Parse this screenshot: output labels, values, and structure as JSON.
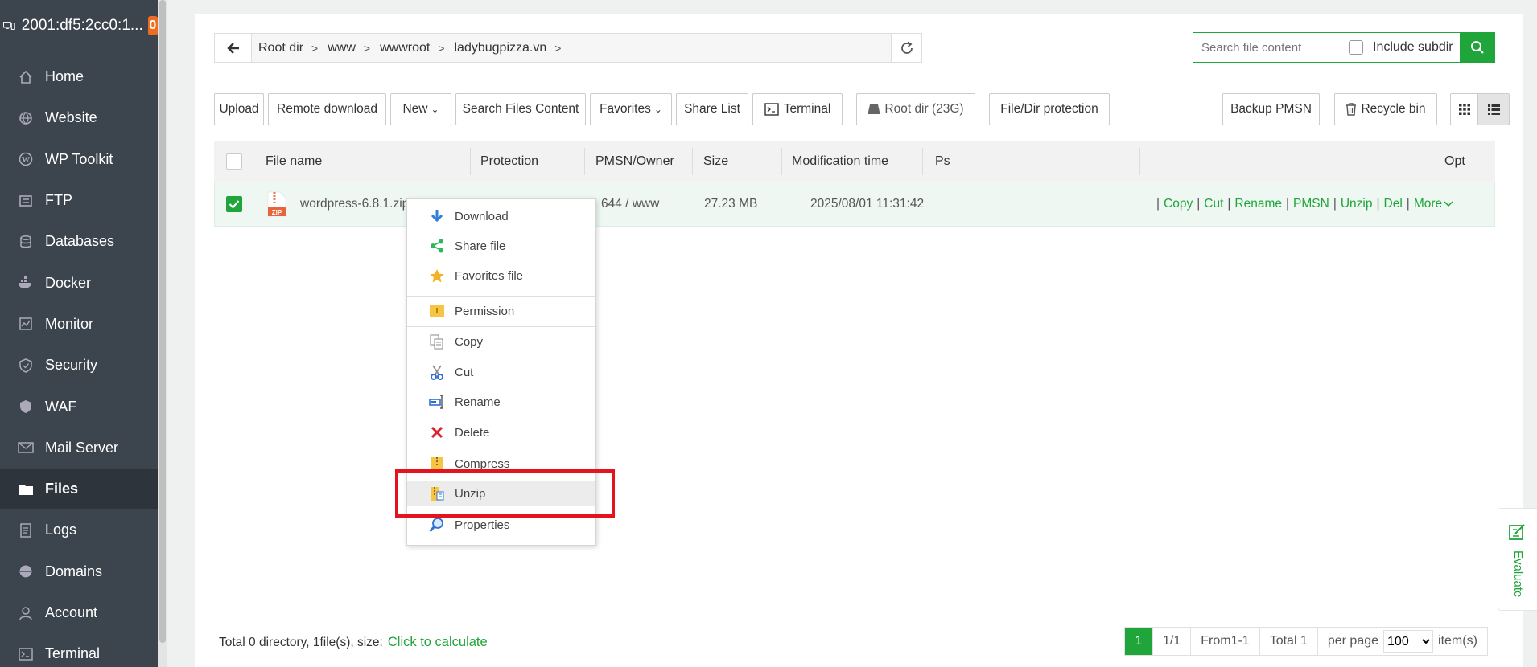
{
  "sidebar": {
    "host": "2001:df5:2cc0:1...",
    "badge": "0",
    "items": [
      {
        "label": "Home"
      },
      {
        "label": "Website"
      },
      {
        "label": "WP Toolkit"
      },
      {
        "label": "FTP"
      },
      {
        "label": "Databases"
      },
      {
        "label": "Docker"
      },
      {
        "label": "Monitor"
      },
      {
        "label": "Security"
      },
      {
        "label": "WAF"
      },
      {
        "label": "Mail Server"
      },
      {
        "label": "Files"
      },
      {
        "label": "Logs"
      },
      {
        "label": "Domains"
      },
      {
        "label": "Account"
      },
      {
        "label": "Terminal"
      }
    ],
    "active": "Files"
  },
  "path": {
    "crumbs": [
      "Root dir",
      "www",
      "wwwroot",
      "ladybugpizza.vn"
    ]
  },
  "search": {
    "placeholder": "Search file content",
    "include_subdir": "Include subdir"
  },
  "toolbar": {
    "upload": "Upload",
    "remote_download": "Remote download",
    "new": "New",
    "search_files": "Search Files Content",
    "favorites": "Favorites",
    "share_list": "Share List",
    "terminal": "Terminal",
    "root_dir": "Root dir (23G)",
    "protection": "File/Dir protection",
    "backup": "Backup PMSN",
    "recycle": "Recycle bin"
  },
  "table": {
    "headers": {
      "name": "File name",
      "protection": "Protection",
      "owner": "PMSN/Owner",
      "size": "Size",
      "mtime": "Modification time",
      "ps": "Ps",
      "opt": "Opt"
    },
    "row": {
      "name": "wordpress-6.8.1.zip",
      "owner": "644 / www",
      "size": "27.23 MB",
      "mtime": "2025/08/01 11:31:42",
      "ops": [
        "Copy",
        "Cut",
        "Rename",
        "PMSN",
        "Unzip",
        "Del",
        "More"
      ]
    }
  },
  "context_menu": {
    "items": [
      "Download",
      "Share file",
      "Favorites file",
      "Permission",
      "Copy",
      "Cut",
      "Rename",
      "Delete",
      "Compress",
      "Unzip",
      "Properties"
    ],
    "highlighted": "Unzip"
  },
  "footer": {
    "summary": "Total 0 directory, 1file(s), size:",
    "calc": "Click to calculate",
    "page": "1",
    "pages": "1/1",
    "range": "From1-1",
    "total": "Total 1",
    "per_page": "per page",
    "per_page_value": "100",
    "items": "item(s)"
  },
  "evaluate": "Evaluate",
  "colors": {
    "accent": "#20a53a",
    "sidebar_bg": "#3c444d",
    "badge": "#f06c21",
    "highlight": "#e3141d"
  }
}
